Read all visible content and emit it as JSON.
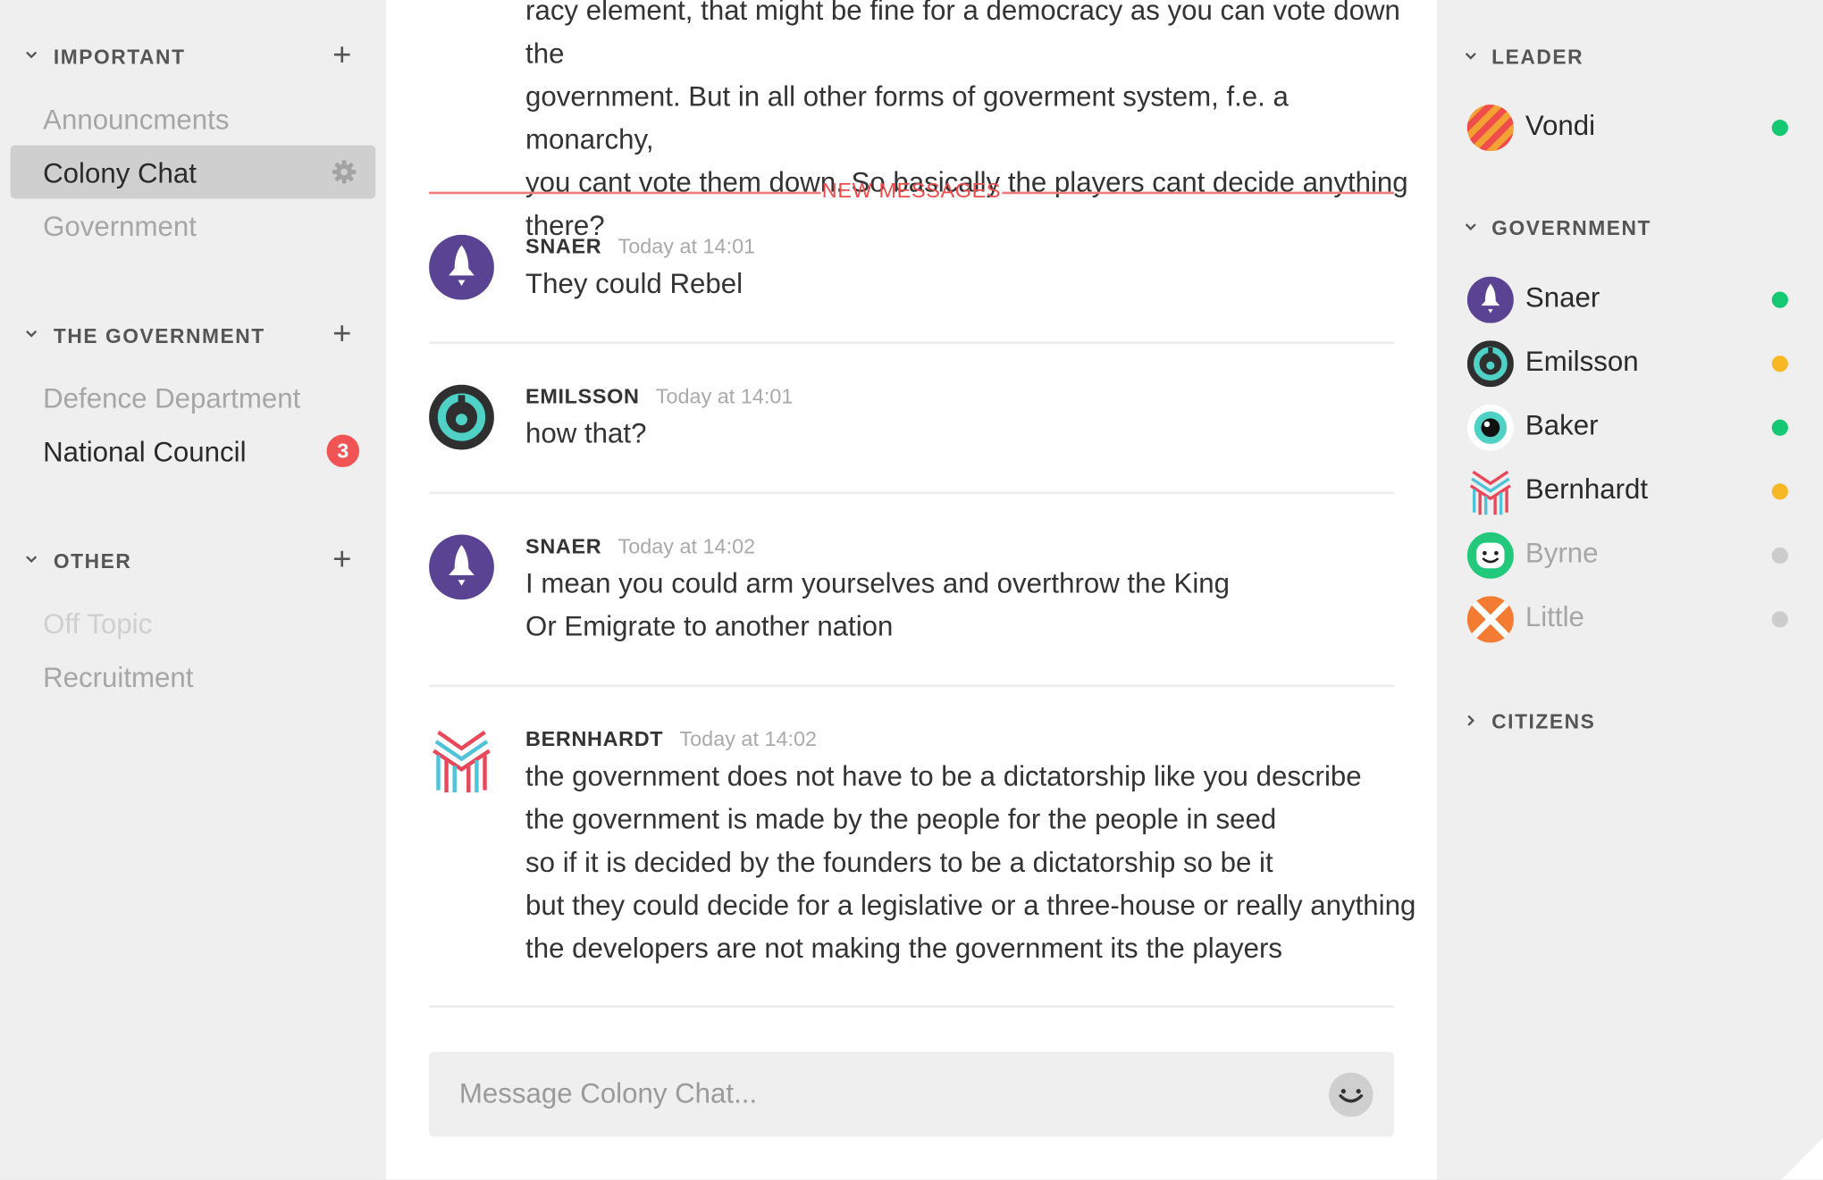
{
  "colors": {
    "online": "#14c972",
    "idle": "#f8b826",
    "offline": "#cccccc",
    "accent_red": "#f05454",
    "new_messages": "#ef4b4b"
  },
  "sidebar": {
    "categories": [
      {
        "title": "IMPORTANT",
        "channels": [
          "Announcments",
          "Colony Chat",
          "Government"
        ]
      },
      {
        "title": "THE GOVERNMENT",
        "channels": [
          "Defence Department",
          "National Council"
        ]
      },
      {
        "title": "OTHER",
        "channels": [
          "Off Topic",
          "Recruitment"
        ]
      }
    ],
    "active_channel": "Colony Chat",
    "unread_badge": "3"
  },
  "chat": {
    "previous_message_lines": [
      "racy element, that might be fine for a democracy as you can vote down the",
      "government. But in all other forms of goverment system, f.e. a monarchy,",
      "you cant vote them down. So basically the players cant decide anything",
      "there?"
    ],
    "new_messages_label": "NEW MESSAGES",
    "messages": [
      {
        "author": "SNAER",
        "time": "Today at 14:01",
        "avatar": "rocket-avatar-icon",
        "lines": [
          "They could Rebel"
        ]
      },
      {
        "author": "EMILSSON",
        "time": "Today at 14:01",
        "avatar": "ring-avatar-icon",
        "lines": [
          "how that?"
        ]
      },
      {
        "author": "SNAER",
        "time": "Today at 14:02",
        "avatar": "rocket-avatar-icon",
        "lines": [
          "I mean you could arm yourselves and overthrow the King",
          "Or Emigrate to another nation"
        ]
      },
      {
        "author": "BERNHARDT",
        "time": "Today at 14:02",
        "avatar": "stripes-avatar-icon",
        "lines": [
          "the government does not have to be a dictatorship like you describe",
          "the government is made by the people for the people in seed",
          "so if it is decided by the founders to be a dictatorship so be it",
          "but they could decide for a legislative or a three-house or really anything",
          "the developers are not making the government its the players"
        ]
      }
    ],
    "composer": {
      "placeholder": "Message Colony Chat..."
    }
  },
  "members": {
    "groups": [
      {
        "title": "LEADER",
        "expanded": true,
        "members": [
          {
            "name": "Vondi",
            "status": "online"
          }
        ]
      },
      {
        "title": "GOVERNMENT",
        "expanded": true,
        "members": [
          {
            "name": "Snaer",
            "status": "online"
          },
          {
            "name": "Emilsson",
            "status": "idle"
          },
          {
            "name": "Baker",
            "status": "online"
          },
          {
            "name": "Bernhardt",
            "status": "idle"
          },
          {
            "name": "Byrne",
            "status": "offline"
          },
          {
            "name": "Little",
            "status": "offline"
          }
        ]
      },
      {
        "title": "CITIZENS",
        "expanded": false,
        "members": []
      }
    ]
  }
}
